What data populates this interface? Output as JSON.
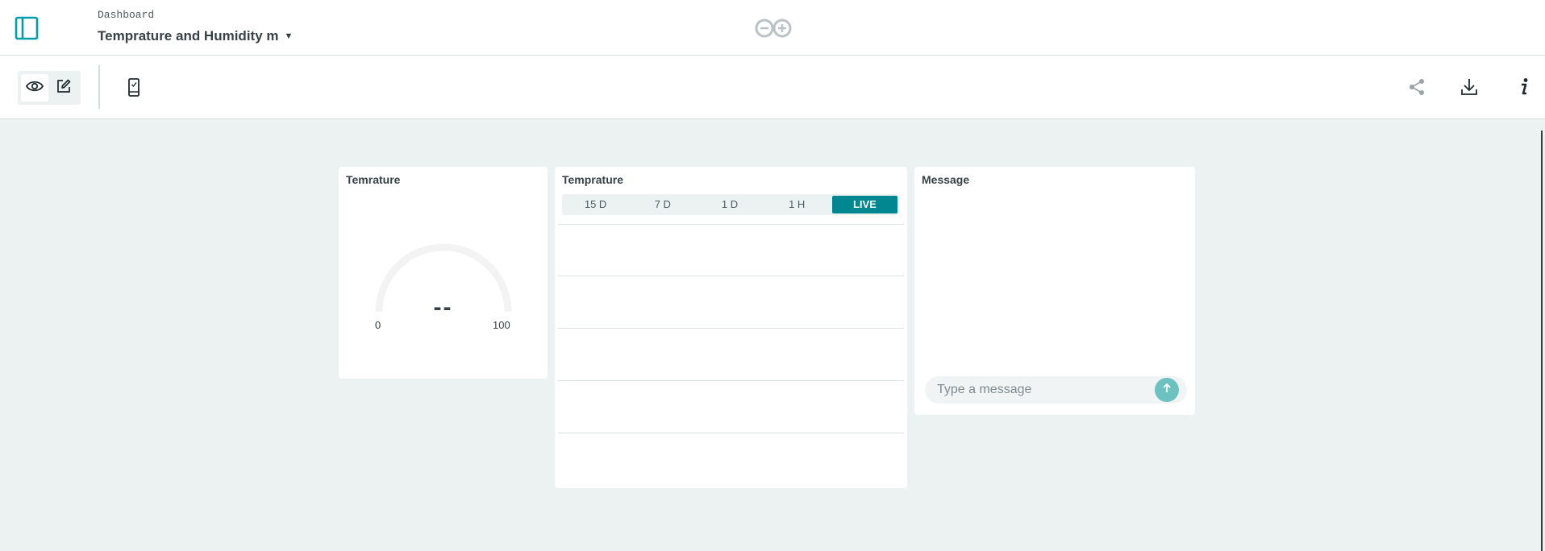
{
  "header": {
    "breadcrumb": "Dashboard",
    "title": "Temprature and Humidity m",
    "title_dropdown_icon": "caret-down-icon",
    "logo_icon": "infinity-logo-icon",
    "sidebar_toggle_icon": "sidebar-panel-icon"
  },
  "toolbar": {
    "view_mode_icon": "eye-icon",
    "edit_mode_icon": "edit-icon",
    "active_mode": "view",
    "device_preview_icon": "phone-icon",
    "share_icon": "share-icon",
    "download_icon": "download-icon",
    "info_icon": "info-icon"
  },
  "widgets": {
    "gauge": {
      "title": "Temrature",
      "value": "--",
      "min": "0",
      "max": "100"
    },
    "chart": {
      "title": "Temprature",
      "ranges": [
        "15 D",
        "7 D",
        "1 D",
        "1 H",
        "LIVE"
      ],
      "active_range": "LIVE"
    },
    "message": {
      "title": "Message",
      "placeholder": "Type a message",
      "value": "",
      "send_icon": "arrow-up-icon"
    }
  },
  "colors": {
    "accent": "#00878f",
    "brand": "#009fa7",
    "send_button": "#6ec1c1",
    "page_background": "#ecf1f1"
  }
}
